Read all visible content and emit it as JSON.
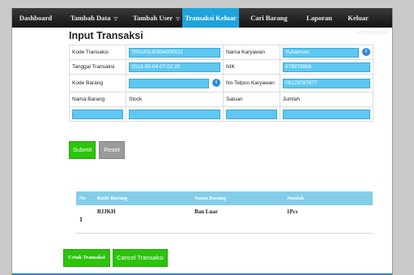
{
  "nav": {
    "items": [
      {
        "label": "Dashboard",
        "caret": ""
      },
      {
        "label": "Tambah Data",
        "caret": "▽"
      },
      {
        "label": "Tambah User",
        "caret": "▽"
      },
      {
        "label": "Transaksi Keluar",
        "caret": ""
      },
      {
        "label": "Cari Barang",
        "caret": ""
      },
      {
        "label": "Laporan",
        "caret": ""
      },
      {
        "label": "Keluar",
        "caret": ""
      }
    ],
    "active_index": 3,
    "user": "Administrator"
  },
  "form": {
    "title": "Input Transaksi",
    "kode_transaksi_label": "Kode Transaksi",
    "kode_transaksi_value": "TRG20130504000011",
    "nama_karyawan_label": "Nama Karyawan",
    "nama_karyawan_value": "Yuharmen",
    "tanggal_label": "Tanggal Transaksi",
    "tanggal_value": "2013-05-04 07:02:25",
    "nik_label": "NIK",
    "nik_value": "678978968",
    "kode_barang_label": "Kode Barang",
    "kode_barang_value": "",
    "telpon_label": "No Telpon Karyawan",
    "telpon_value": "08129787677",
    "col_nama_barang": "Nama Barang",
    "col_stock": "Stock",
    "col_satuan": "Satuan",
    "col_jumlah": "Jumlah",
    "submit_label": "Submit",
    "reset_label": "Reset"
  },
  "result": {
    "headers": [
      "No",
      "Kode Barang",
      "Nama Barang",
      "Jumlah"
    ],
    "rows": [
      {
        "no": "1",
        "kode": "BJJKH",
        "nama": "Ban Luar",
        "jumlah": "1Pcs"
      }
    ]
  },
  "actions": {
    "cetak_label": "Cetak Transaksi",
    "cancel_label": "Cancel Transaksi"
  },
  "colors": {
    "accent": "#1fa3dc",
    "field": "#5ec8f2",
    "button_green": "#2bc30b",
    "table_header": "#84cde8"
  }
}
